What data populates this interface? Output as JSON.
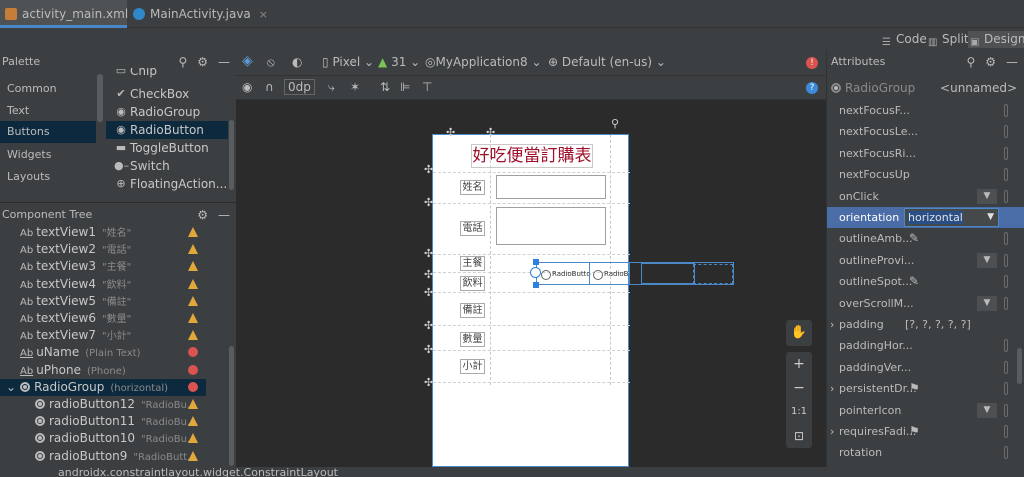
{
  "tabs": [
    {
      "label": "activity_main.xml",
      "close": "×"
    },
    {
      "label": "MainActivity.java",
      "close": "×"
    }
  ],
  "view_modes": {
    "code": "Code",
    "split": "Split",
    "design": "Design"
  },
  "palette": {
    "title": "Palette",
    "categories": [
      "Common",
      "Text",
      "Buttons",
      "Widgets",
      "Layouts"
    ],
    "widgets": [
      "Chip",
      "CheckBox",
      "RadioGroup",
      "RadioButton",
      "ToggleButton",
      "Switch",
      "FloatingAction..."
    ]
  },
  "component_tree": {
    "title": "Component Tree",
    "items": [
      {
        "name": "textView1",
        "hint": "\"姓名\"",
        "status": "warning"
      },
      {
        "name": "textView2",
        "hint": "\"電話\"",
        "status": "warning"
      },
      {
        "name": "textView3",
        "hint": "\"主餐\"",
        "status": "warning"
      },
      {
        "name": "textView4",
        "hint": "\"飲料\"",
        "status": "warning"
      },
      {
        "name": "textView5",
        "hint": "\"備註\"",
        "status": "warning"
      },
      {
        "name": "textView6",
        "hint": "\"數量\"",
        "status": "warning"
      },
      {
        "name": "textView7",
        "hint": "\"小計\"",
        "status": "warning"
      },
      {
        "name": "uName",
        "hint": "(Plain Text)",
        "status": "error"
      },
      {
        "name": "uPhone",
        "hint": "(Phone)",
        "status": "error"
      },
      {
        "name": "RadioGroup",
        "hint": "(horizontal)",
        "status": "error"
      },
      {
        "name": "radioButton12",
        "hint": "\"RadioBu...",
        "status": "warning"
      },
      {
        "name": "radioButton11",
        "hint": "\"RadioBu...",
        "status": "warning"
      },
      {
        "name": "radioButton10",
        "hint": "\"RadioBu...",
        "status": "warning"
      },
      {
        "name": "radioButton9",
        "hint": "\"RadioButt...",
        "status": "warning"
      }
    ],
    "ab_prefix": "Ab"
  },
  "status_bar": {
    "text": "androidx.constraintlayout.widget.ConstraintLayout"
  },
  "toolbar": {
    "device": "Pixel",
    "api": "31",
    "app": "MyApplication8",
    "locale": "Default (en-us)",
    "margin": "0dp"
  },
  "preview": {
    "title": "好吃便當訂購表",
    "labels": [
      "姓名",
      "電話",
      "主餐",
      "飲料",
      "備註",
      "數量",
      "小計"
    ],
    "radio_buttons": [
      "RadioButton",
      "RadioBu"
    ]
  },
  "zoom": {
    "plus": "+",
    "minus": "−",
    "one_to_one": "1:1"
  },
  "attributes": {
    "title": "Attributes",
    "component": "RadioGroup",
    "id_value": "<unnamed>",
    "rows": [
      {
        "name": "nextFocusF...",
        "kind": "indicator"
      },
      {
        "name": "nextFocusLe...",
        "kind": "indicator"
      },
      {
        "name": "nextFocusRi...",
        "kind": "indicator"
      },
      {
        "name": "nextFocusUp",
        "kind": "indicator"
      },
      {
        "name": "onClick",
        "kind": "dropdown"
      },
      {
        "name": "orientation",
        "kind": "selected",
        "value": "horizontal"
      },
      {
        "name": "outlineAmb...",
        "kind": "picker"
      },
      {
        "name": "outlineProvi...",
        "kind": "dropdown"
      },
      {
        "name": "outlineSpot...",
        "kind": "picker"
      },
      {
        "name": "overScrollM...",
        "kind": "dropdown"
      },
      {
        "name": "padding",
        "kind": "expand",
        "value": "[?, ?, ?, ?, ?]"
      },
      {
        "name": "paddingHor...",
        "kind": "indicator"
      },
      {
        "name": "paddingVer...",
        "kind": "indicator"
      },
      {
        "name": "persistentDr...",
        "kind": "expand-flag"
      },
      {
        "name": "pointerIcon",
        "kind": "dropdown"
      },
      {
        "name": "requiresFadi...",
        "kind": "expand-flag"
      },
      {
        "name": "rotation",
        "kind": "indicator"
      }
    ]
  },
  "colors": {
    "accent": "#4a88c7",
    "warning": "#e2a73a",
    "error": "#d9534f",
    "title_red": "#a0102a"
  }
}
